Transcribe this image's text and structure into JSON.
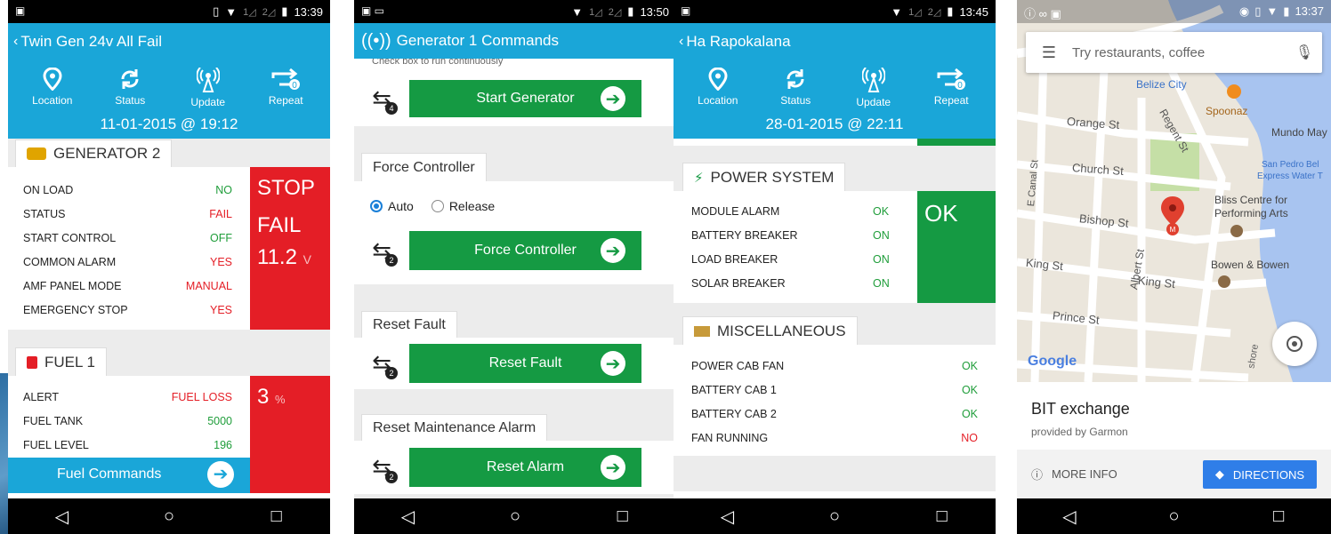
{
  "phone1": {
    "status": {
      "time": "13:39"
    },
    "title": "Twin Gen 24v All Fail",
    "tools": [
      {
        "label": "Location",
        "icon": "location-pin-icon"
      },
      {
        "label": "Status",
        "icon": "refresh-icon"
      },
      {
        "label": "Update",
        "icon": "antenna-icon"
      },
      {
        "label": "Repeat",
        "icon": "repeat-icon"
      }
    ],
    "timestamp": "11-01-2015 @ 19:12",
    "generator": {
      "title": "GENERATOR 2",
      "rows": [
        {
          "label": "ON LOAD",
          "value": "NO"
        },
        {
          "label": "STATUS",
          "value": "FAIL"
        },
        {
          "label": "START CONTROL",
          "value": "OFF"
        },
        {
          "label": "COMMON ALARM",
          "value": "YES"
        },
        {
          "label": "AMF PANEL MODE",
          "value": "MANUAL"
        },
        {
          "label": "EMERGENCY STOP",
          "value": "YES"
        }
      ],
      "big1": "STOP",
      "big2": "FAIL",
      "big3": "11.2",
      "big3_unit": "V"
    },
    "fuel": {
      "title": "FUEL 1",
      "rows": [
        {
          "label": "ALERT",
          "value": "FUEL LOSS"
        },
        {
          "label": "FUEL TANK",
          "value": "5000"
        },
        {
          "label": "FUEL LEVEL",
          "value": "196"
        }
      ],
      "big": "3",
      "big_unit": "%",
      "cmd": "Fuel Commands"
    }
  },
  "phone2": {
    "status": {
      "time": "13:50"
    },
    "title": "Generator 1 Commands",
    "cut_text": "Check box to run continuously",
    "start": {
      "label": "Start Generator",
      "badge": "4"
    },
    "force": {
      "title": "Force Controller",
      "opt_auto": "Auto",
      "opt_release": "Release",
      "label": "Force Controller",
      "badge": "2"
    },
    "reset": {
      "title": "Reset Fault",
      "label": "Reset Fault",
      "badge": "2"
    },
    "maint": {
      "title": "Reset Maintenance Alarm",
      "label": "Reset Alarm",
      "badge": "2"
    }
  },
  "phone3": {
    "status": {
      "time": "13:45"
    },
    "title": "Ha Rapokalana",
    "tools": [
      {
        "label": "Location",
        "icon": "location-pin-icon"
      },
      {
        "label": "Status",
        "icon": "refresh-icon"
      },
      {
        "label": "Update",
        "icon": "antenna-icon"
      },
      {
        "label": "Repeat",
        "icon": "repeat-icon"
      }
    ],
    "timestamp": "28-01-2015 @ 22:11",
    "power": {
      "title": "POWER SYSTEM",
      "rows": [
        {
          "label": "MODULE ALARM",
          "value": "OK"
        },
        {
          "label": "BATTERY BREAKER",
          "value": "ON"
        },
        {
          "label": "LOAD BREAKER",
          "value": "ON"
        },
        {
          "label": "SOLAR BREAKER",
          "value": "ON"
        }
      ],
      "big": "OK"
    },
    "misc": {
      "title": "MISCELLANEOUS",
      "rows": [
        {
          "label": "POWER CAB FAN",
          "value": "OK"
        },
        {
          "label": "BATTERY CAB 1",
          "value": "OK"
        },
        {
          "label": "BATTERY CAB 2",
          "value": "OK"
        },
        {
          "label": "FAN RUNNING",
          "value": "NO"
        }
      ]
    }
  },
  "phone4": {
    "status": {
      "time": "13:37"
    },
    "search_placeholder": "Try restaurants, coffee",
    "labels": {
      "belize": "Belize City",
      "spoonaz": "Spoonaz",
      "mundo": "Mundo May",
      "sanpedro": "San Pedro Bel",
      "express": "Express Water T",
      "bliss1": "Bliss Centre for",
      "bliss2": "Performing Arts",
      "bowen": "Bowen & Bowen",
      "orange": "Orange St",
      "church": "Church St",
      "bishop": "Bishop St",
      "king1": "King St",
      "king2": "King St",
      "prince": "Prince St",
      "albert": "Albert St",
      "regent": "Regent St",
      "ecanal": "E Canal St",
      "shore": "shore"
    },
    "google": "Google",
    "place_name": "BIT exchange",
    "provider": "provided by Garmon",
    "more_info": "MORE INFO",
    "directions": "DIRECTIONS"
  },
  "colors": {
    "blue": "#1aa6d8",
    "red": "#e41e26",
    "green": "#159a43",
    "map_blue": "#2f7ee8"
  }
}
